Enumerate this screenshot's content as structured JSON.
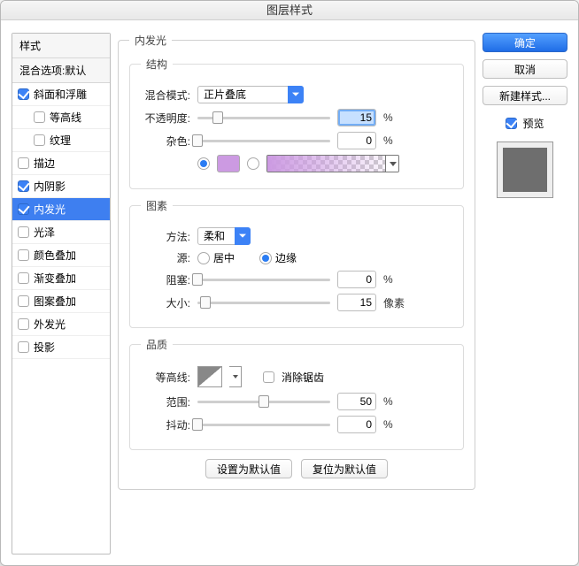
{
  "title": "图层样式",
  "sidebar": {
    "styles_header": "样式",
    "blend_header": "混合选项:默认",
    "items": [
      {
        "label": "斜面和浮雕",
        "checked": true,
        "indent": 0
      },
      {
        "label": "等高线",
        "checked": false,
        "indent": 1
      },
      {
        "label": "纹理",
        "checked": false,
        "indent": 1
      },
      {
        "label": "描边",
        "checked": false,
        "indent": 0
      },
      {
        "label": "内阴影",
        "checked": true,
        "indent": 0
      },
      {
        "label": "内发光",
        "checked": true,
        "indent": 0,
        "selected": true
      },
      {
        "label": "光泽",
        "checked": false,
        "indent": 0
      },
      {
        "label": "颜色叠加",
        "checked": false,
        "indent": 0
      },
      {
        "label": "渐变叠加",
        "checked": false,
        "indent": 0
      },
      {
        "label": "图案叠加",
        "checked": false,
        "indent": 0
      },
      {
        "label": "外发光",
        "checked": false,
        "indent": 0
      },
      {
        "label": "投影",
        "checked": false,
        "indent": 0
      }
    ]
  },
  "panel": {
    "group_title": "内发光",
    "structure": {
      "title": "结构",
      "blend_mode_label": "混合模式:",
      "blend_mode_value": "正片叠底",
      "opacity_label": "不透明度:",
      "opacity_value": "15",
      "pct_a": "%",
      "noise_label": "杂色:",
      "noise_value": "0",
      "pct_b": "%",
      "color_hex": "#cc9ae2"
    },
    "elements": {
      "title": "图素",
      "technique_label": "方法:",
      "technique_value": "柔和",
      "source_label": "源:",
      "source_center": "居中",
      "source_edge": "边缘",
      "choke_label": "阻塞:",
      "choke_value": "0",
      "pct_c": "%",
      "size_label": "大小:",
      "size_value": "15",
      "size_unit": "像素"
    },
    "quality": {
      "title": "品质",
      "contour_label": "等高线:",
      "antialias_label": "消除锯齿",
      "range_label": "范围:",
      "range_value": "50",
      "pct_d": "%",
      "jitter_label": "抖动:",
      "jitter_value": "0",
      "pct_e": "%"
    },
    "defaults": {
      "make_default": "设置为默认值",
      "reset_default": "复位为默认值"
    }
  },
  "right": {
    "ok": "确定",
    "cancel": "取消",
    "new_style": "新建样式...",
    "preview_label": "预览"
  }
}
